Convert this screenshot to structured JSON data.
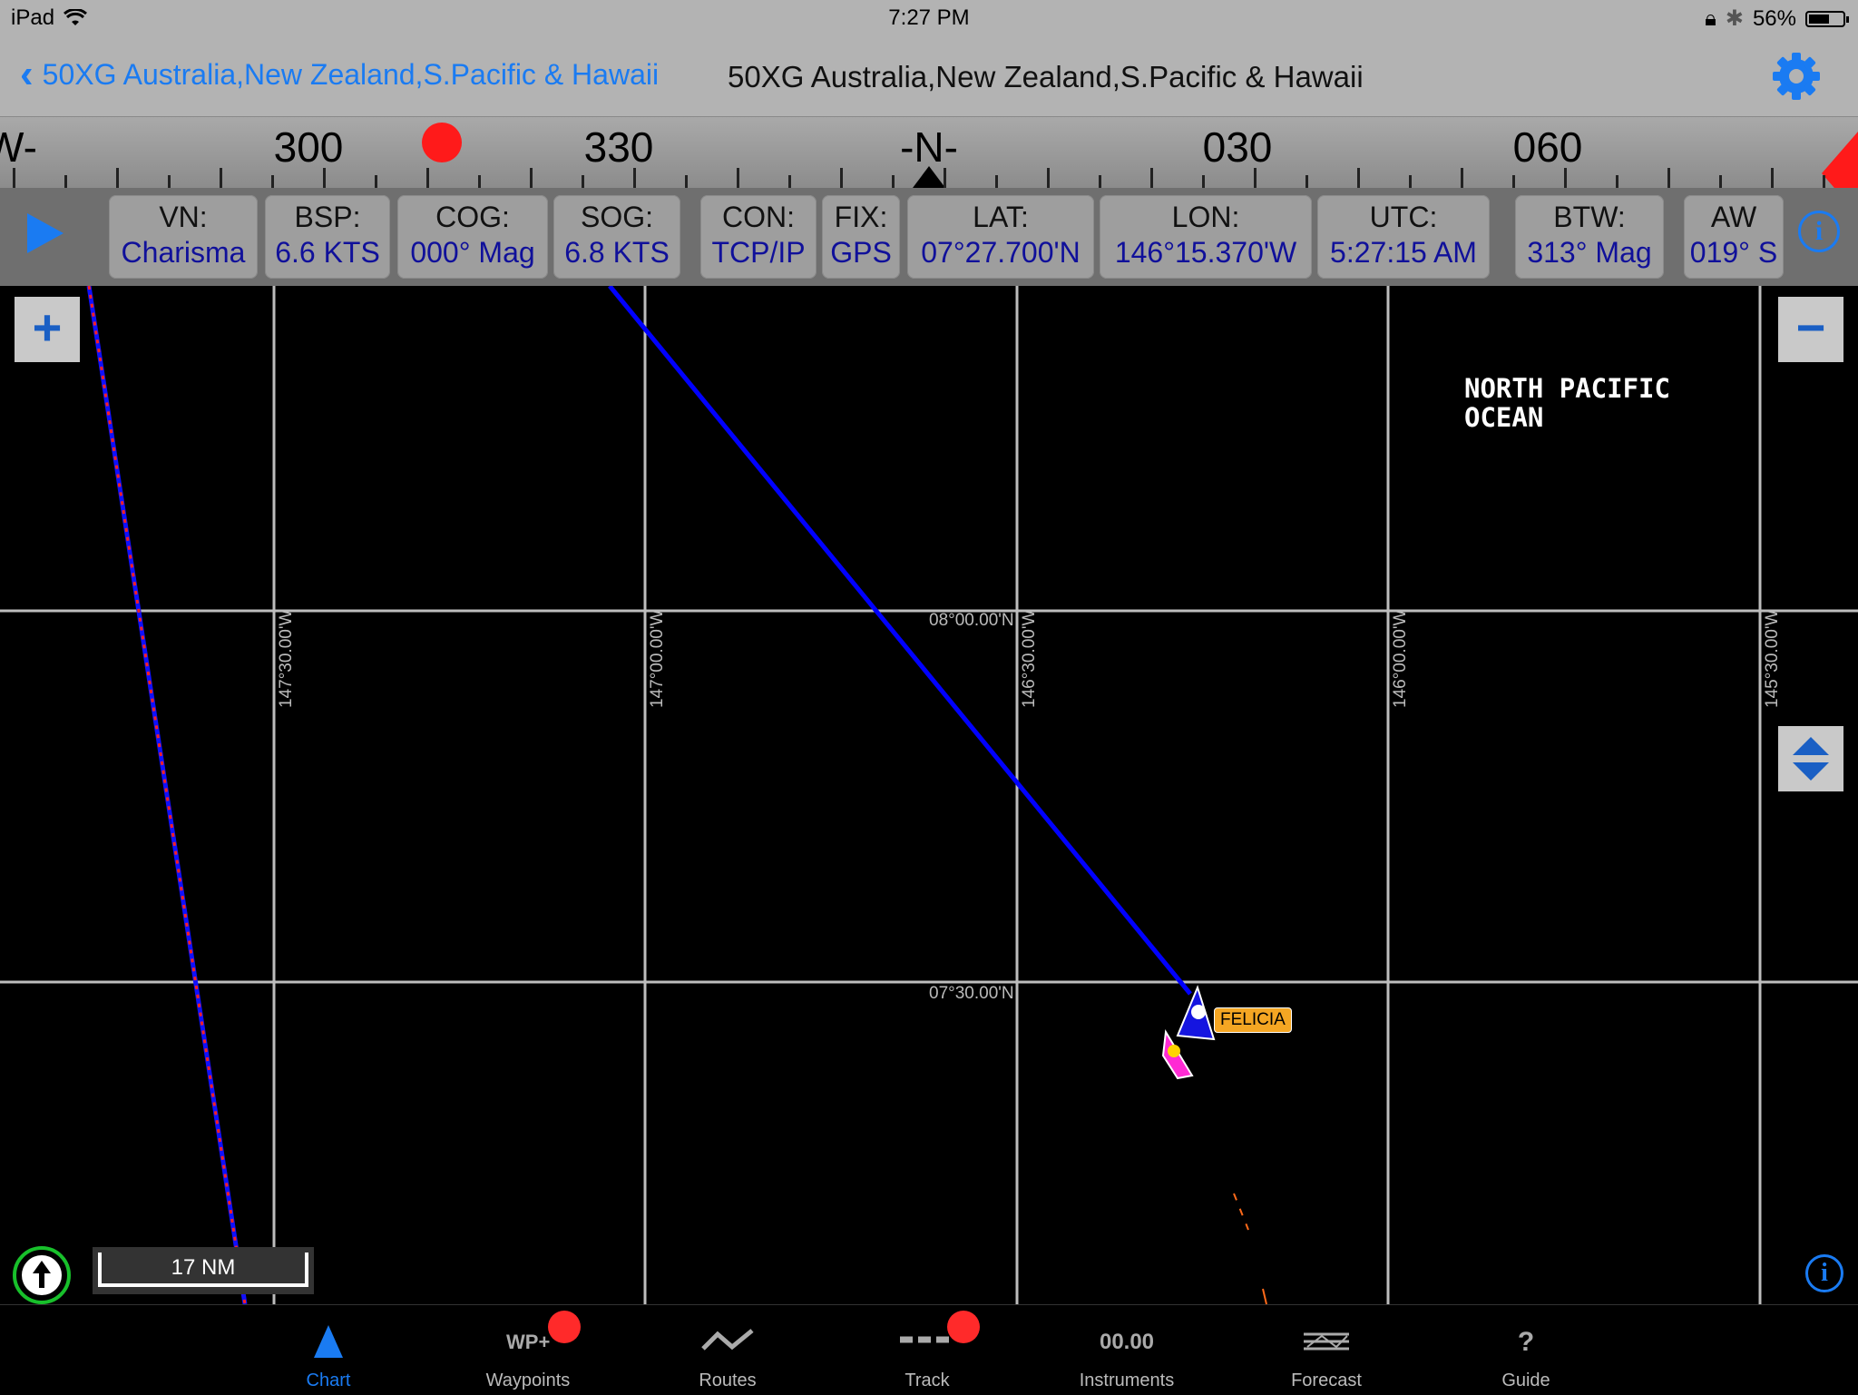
{
  "status_bar": {
    "device": "iPad",
    "time": "7:27 PM",
    "battery": "56%"
  },
  "nav": {
    "back_label": "50XG Australia,New Zealand,S.Pacific & Hawaii",
    "title": "50XG Australia,New Zealand,S.Pacific & Hawaii"
  },
  "compass": {
    "labels": [
      "W-",
      "300",
      "330",
      "-N-",
      "030",
      "060"
    ]
  },
  "instruments": [
    {
      "label": "VN:",
      "value": "Charisma"
    },
    {
      "label": "BSP:",
      "value": "6.6 KTS"
    },
    {
      "label": "COG:",
      "value": "000° Mag"
    },
    {
      "label": "SOG:",
      "value": "6.8 KTS"
    },
    {
      "label": "CON:",
      "value": "TCP/IP"
    },
    {
      "label": "FIX:",
      "value": "GPS"
    },
    {
      "label": "LAT:",
      "value": "07°27.700'N"
    },
    {
      "label": "LON:",
      "value": "146°15.370'W"
    },
    {
      "label": "UTC:",
      "value": "5:27:15 AM"
    },
    {
      "label": "BTW:",
      "value": "313° Mag"
    },
    {
      "label": "AW",
      "value": "019° S"
    }
  ],
  "chart": {
    "ocean_label": "NORTH PACIFIC\nOCEAN",
    "lon_labels": [
      "147°30.00'W",
      "147°00.00'W",
      "146°30.00'W",
      "146°00.00'W",
      "145°30.00'W"
    ],
    "lat_labels": [
      "08°00.00'N",
      "07°30.00'N"
    ],
    "vessel_label": "FELICIA",
    "scale": "17 NM",
    "zoom_in": "+",
    "zoom_out": "−"
  },
  "tabs": [
    {
      "label": "Chart",
      "icon": "chart-icon",
      "active": true
    },
    {
      "label": "Waypoints",
      "icon": "waypoint-add-icon",
      "badge": true
    },
    {
      "label": "Routes",
      "icon": "route-icon"
    },
    {
      "label": "Track",
      "icon": "track-icon",
      "badge": true
    },
    {
      "label": "Instruments",
      "icon": "instruments-icon",
      "icon_text": "00.00"
    },
    {
      "label": "Forecast",
      "icon": "forecast-icon"
    },
    {
      "label": "Guide",
      "icon": "guide-icon",
      "icon_text": "?"
    }
  ],
  "colors": {
    "accent": "#1a7bf2",
    "route": "#0000ff",
    "alert": "#ff1a1a",
    "vessel_label": "#f5a623"
  }
}
